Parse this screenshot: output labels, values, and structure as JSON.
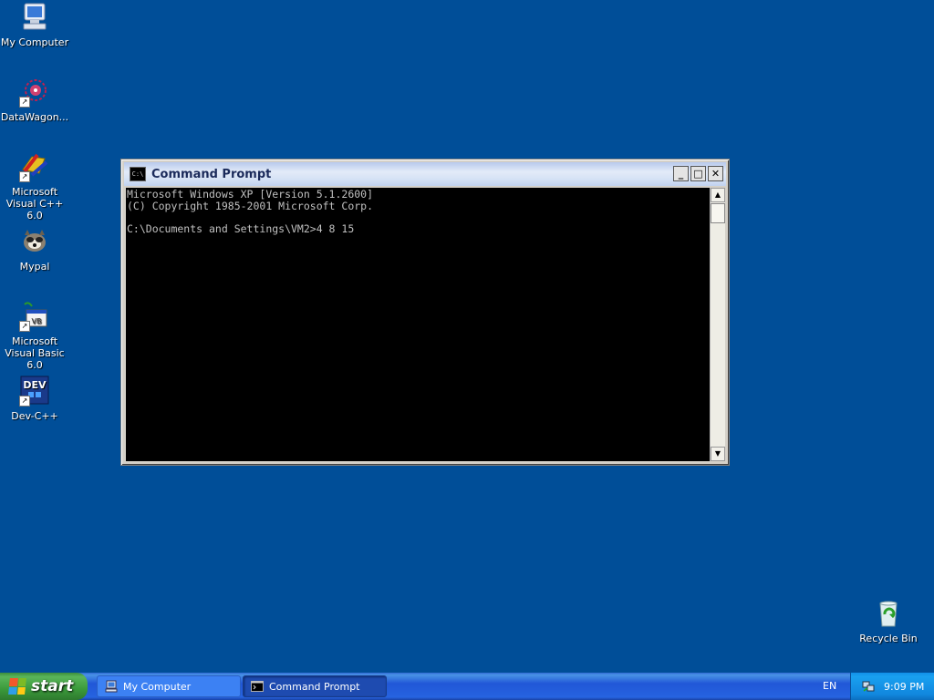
{
  "desktop": {
    "icons": [
      {
        "label": "My Computer",
        "icon": "my-computer-icon"
      },
      {
        "label": "DataWagon...",
        "icon": "datawagon-icon"
      },
      {
        "label": "Microsoft Visual C++ 6.0",
        "icon": "visual-cpp-icon"
      },
      {
        "label": "Mypal",
        "icon": "mypal-icon"
      },
      {
        "label": "Microsoft Visual Basic 6.0",
        "icon": "visual-basic-icon"
      },
      {
        "label": "Dev-C++",
        "icon": "dev-cpp-icon"
      },
      {
        "label": "Recycle Bin",
        "icon": "recycle-bin-icon"
      }
    ]
  },
  "window": {
    "title": "Command Prompt",
    "title_icon_text": "C:\\",
    "console_lines": [
      "Microsoft Windows XP [Version 5.1.2600]",
      "(C) Copyright 1985-2001 Microsoft Corp.",
      "",
      "C:\\Documents and Settings\\VM2>4 8 15"
    ],
    "minimize": "_",
    "maximize": "□",
    "close": "✕"
  },
  "taskbar": {
    "start_label": "start",
    "buttons": [
      {
        "label": "My Computer",
        "icon": "my-computer-icon",
        "active": false
      },
      {
        "label": "Command Prompt",
        "icon": "command-prompt-icon",
        "active": true
      }
    ],
    "language": "EN",
    "clock": "9:09 PM"
  }
}
